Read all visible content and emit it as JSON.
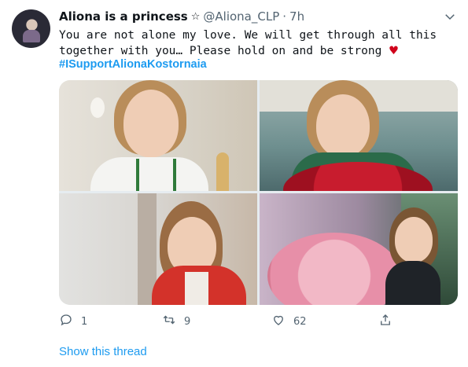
{
  "author": {
    "display_name": "Aliona is a princess",
    "badge_icon": "star-outline-icon",
    "handle": "@Aliona_CLP",
    "separator": "·",
    "time": "7h"
  },
  "tweet": {
    "text_line1": "You are not alone my love. We will get through all this",
    "text_line2": "together with you… Please hold on and be strong",
    "heart_emoji": "♥",
    "hashtag": "#ISupportAlionaKostornaia"
  },
  "media": {
    "photo_count": 4
  },
  "actions": {
    "reply_count": "1",
    "retweet_count": "9",
    "like_count": "62"
  },
  "thread": {
    "link_text": "Show this thread"
  },
  "colors": {
    "link_blue": "#1d9bf0",
    "muted_gray": "#536471",
    "heart_red": "#d0021b"
  }
}
